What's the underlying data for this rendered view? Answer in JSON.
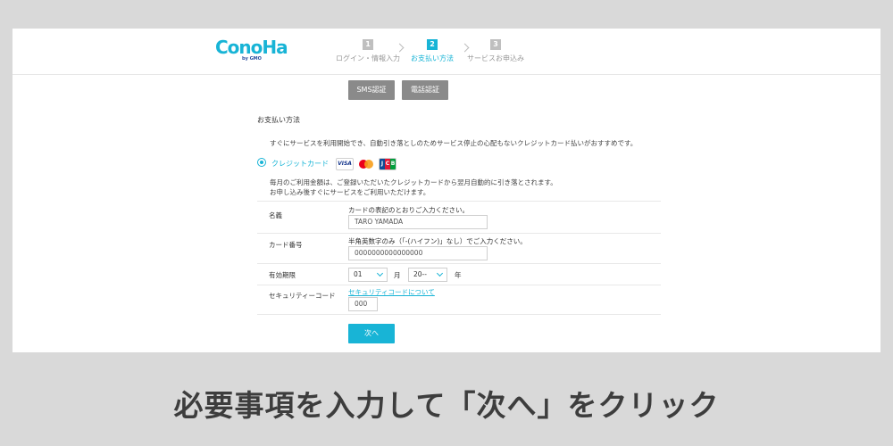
{
  "logo": {
    "text": "ConoHa",
    "sub": "by GMO"
  },
  "steps": [
    {
      "num": "1",
      "label": "ログイン・情報入力"
    },
    {
      "num": "2",
      "label": "お支払い方法"
    },
    {
      "num": "3",
      "label": "サービスお申込み"
    }
  ],
  "verify_buttons": {
    "sms": "SMS認証",
    "phone": "電話認証"
  },
  "payment": {
    "title": "お支払い方法",
    "description": "すぐにサービスを利用開始でき、自動引き落としのためサービス停止の心配もないクレジットカード払いがおすすめです。",
    "option_label": "クレジットカード",
    "brands": {
      "visa": "VISA",
      "jcb": [
        "J",
        "C",
        "B"
      ]
    },
    "note_line1": "毎月のご利用金額は、ご登録いただいたクレジットカードから翌月自動的に引き落とされます。",
    "note_line2": "お申し込み後すぐにサービスをご利用いただけます。"
  },
  "form": {
    "name": {
      "label": "名義",
      "hint": "カードの表記のとおりご入力ください。",
      "value": "TARO YAMADA"
    },
    "card_number": {
      "label": "カード番号",
      "hint": "半角英数字のみ（「-(ハイフン)」なし）でご入力ください。",
      "value": "0000000000000000"
    },
    "expiry": {
      "label": "有効期限",
      "month_value": "01",
      "month_unit": "月",
      "year_value": "20--",
      "year_unit": "年"
    },
    "security": {
      "label": "セキュリティーコード",
      "link": "セキュリティコードについて",
      "value": "000"
    }
  },
  "next_button": "次へ",
  "caption": "必要事項を入力して「次へ」をクリック",
  "colors": {
    "accent": "#18b4d6",
    "gray_button": "#8a8a8a",
    "background": "#d9d9d9"
  }
}
